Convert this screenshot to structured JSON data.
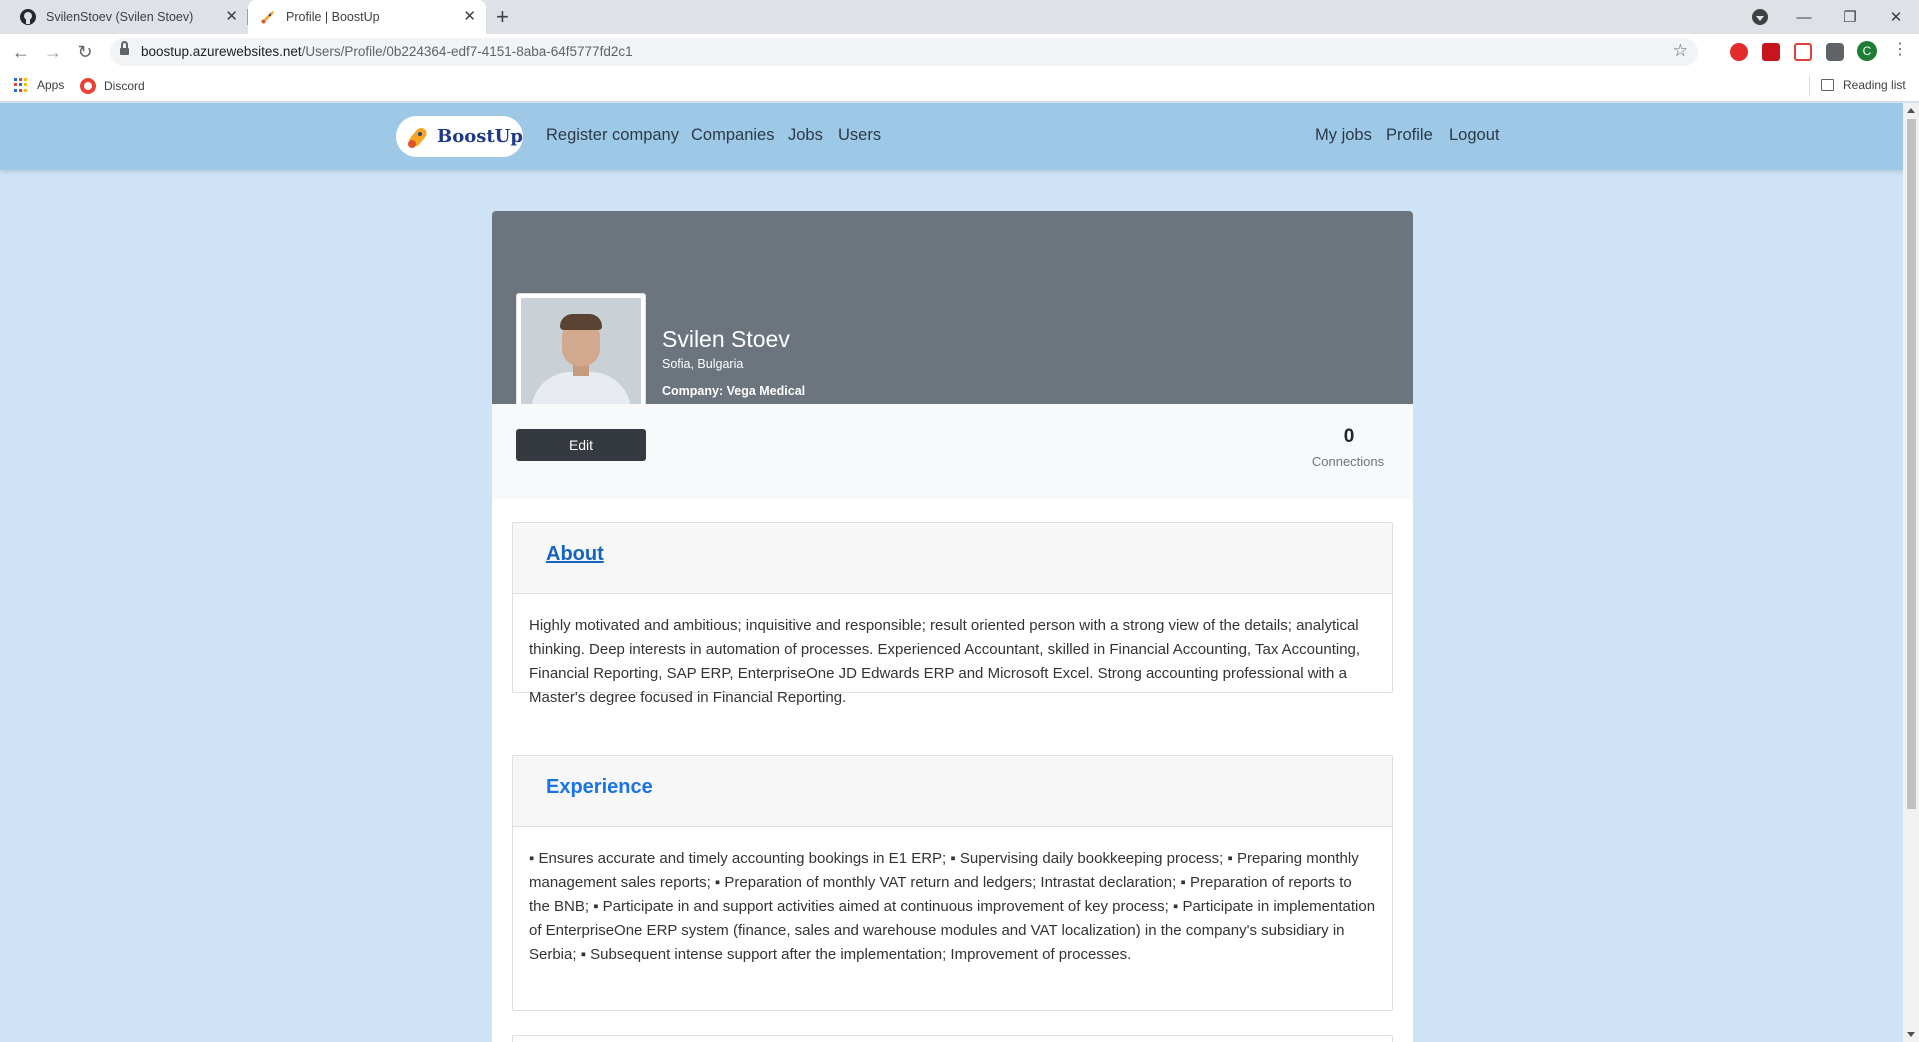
{
  "browser": {
    "tabs": [
      {
        "title": "SvilenStoev (Svilen Stoev)",
        "icon": "github-icon",
        "active": false
      },
      {
        "title": "Profile | BoostUp",
        "icon": "rocket-icon",
        "active": true
      }
    ],
    "url_domain": "boostup.azurewebsites.net",
    "url_path": "/Users/Profile/0b224364-edf7-4151-8aba-64f5777fd2c1",
    "bookmarks": [
      {
        "label": "Apps",
        "icon": "apps-grid-icon"
      },
      {
        "label": "Discord",
        "icon": "discord-icon"
      }
    ],
    "reading_list": "Reading list",
    "profile_initial": "C"
  },
  "site": {
    "brand": "BoostUp",
    "nav_left": [
      "Register company",
      "Companies",
      "Jobs",
      "Users"
    ],
    "nav_right": [
      "My jobs",
      "Profile",
      "Logout"
    ]
  },
  "profile": {
    "name": "Svilen Stoev",
    "location": "Sofia, Bulgaria",
    "company_label": "Company:",
    "company": "Vega Medical",
    "edit_label": "Edit",
    "connections_count": "0",
    "connections_label": "Connections"
  },
  "sections": {
    "about": {
      "title": "About",
      "text": "Highly motivated and ambitious; inquisitive and responsible; result oriented person with a strong view of the details; analytical thinking. Deep interests in automation of processes. Experienced Accountant, skilled in Financial Accounting, Tax Accounting, Financial Reporting, SAP ERP, EnterpriseOne JD Edwards ERP and Microsoft Excel. Strong accounting professional with a Master's degree focused in Financial Reporting."
    },
    "experience": {
      "title": "Experience",
      "text": "▪ Ensures accurate and timely accounting bookings in E1 ERP; ▪ Supervising daily bookkeeping process; ▪ Preparing monthly management sales reports; ▪ Preparation of monthly VAT return and ledgers; Intrastat declaration; ▪ Preparation of reports to the BNB; ▪ Participate in and support activities aimed at continuous improvement of key process; ▪ Participate in implementation of EnterpriseOne ERP system (finance, sales and warehouse modules and VAT localization) in the company's subsidiary in Serbia; ▪ Subsequent intense support after the implementation; Improvement of processes."
    }
  },
  "colors": {
    "nav_bg": "#9ec9e6",
    "page_bg": "#cfe3f7",
    "cover_bg": "#6c757d",
    "link_blue": "#1a73e8"
  }
}
